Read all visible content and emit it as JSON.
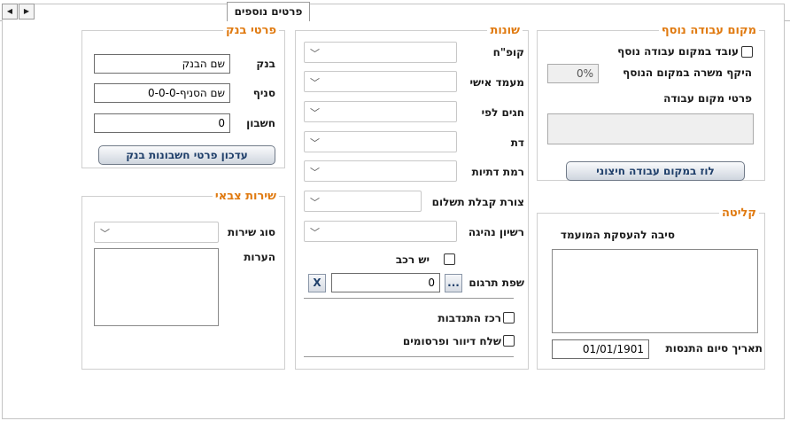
{
  "tabs": {
    "scroll_left": "◀",
    "scroll_right": "▶",
    "active_label": "פרטים נוספים"
  },
  "additional_workplace": {
    "legend": "מקום עבודה נוסף",
    "works_additional_label": "עובד במקום עבודה נוסף",
    "scope_label": "היקף משרה במקום הנוסף",
    "scope_value": "0%",
    "details_label": "פרטי מקום עבודה",
    "external_schedule_button": "לוז במקום עבודה חיצוני"
  },
  "intake": {
    "legend": "קליטה",
    "reason_label": "סיבה להעסקת המועמד",
    "end_date_label": "תאריך סיום התנסות",
    "end_date_value": "01/01/1901"
  },
  "misc": {
    "legend": "שונות",
    "health_fund_label": "קופ\"ח",
    "personal_status_label": "מעמד אישי",
    "holidays_label": "חגים לפי",
    "religion_label": "דת",
    "religiosity_label": "רמת דתיות",
    "payment_method_label": "צורת קבלת תשלום",
    "license_label": "רשיון נהיגה",
    "has_car_label": "יש רכב",
    "translation_language_label": "שפת תרגום",
    "translation_language_value": "0",
    "browse_button": "...",
    "clear_button": "X",
    "volunteer_coordinator_label": "רכז התנדבות",
    "send_mail_label": "שלח דיוור ופרסומים"
  },
  "bank": {
    "legend": "פרטי בנק",
    "bank_label": "בנק",
    "bank_value": "שם הבנק",
    "branch_label": "סניף",
    "branch_value": "שם הסניף-0-0-0",
    "account_label": "חשבון",
    "account_value": "0",
    "update_button": "עדכון פרטי חשבונות בנק"
  },
  "military": {
    "legend": "שירות צבאי",
    "service_type_label": "סוג שירות",
    "notes_label": "הערות"
  },
  "icons": {
    "chevron": "﹀"
  }
}
